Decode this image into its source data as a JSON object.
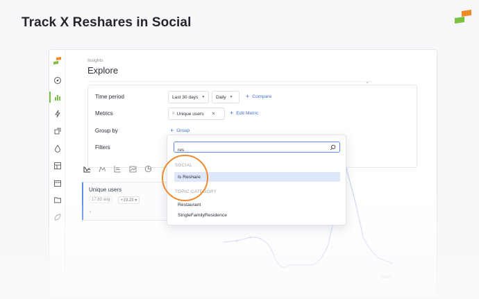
{
  "page_title": "Track X Reshares in Social",
  "colors": {
    "accent_blue": "#3d6fd6",
    "brand_green": "#7cc242",
    "brand_orange": "#f08a24",
    "highlight_ring": "#ee8a2e"
  },
  "sidebar": {
    "icons": [
      "compass-icon",
      "bar-chart-icon",
      "lightning-icon",
      "share-icon",
      "drop-icon",
      "layout-icon",
      "calendar-icon",
      "folder-icon",
      "leaf-icon"
    ],
    "active": "bar-chart-icon"
  },
  "header": {
    "breadcrumb": "Insights",
    "title": "Explore"
  },
  "filters": {
    "time_period": {
      "label": "Time period",
      "range": "Last 30 days",
      "granularity": "Daily",
      "compare": "Compare"
    },
    "metrics": {
      "label": "Metrics",
      "chip": "Unique users",
      "edit": "Edit Metric"
    },
    "group_by": {
      "label": "Group by",
      "add": "Group"
    },
    "filters_label": "Filters"
  },
  "metric_card": {
    "title": "Unique users",
    "avg": "17.63 avg",
    "delta": "+19.23"
  },
  "chart_data": {
    "type": "line",
    "x": [],
    "values": [],
    "x_tick_labels": [
      "Oct 23"
    ]
  },
  "dropdown": {
    "search": {
      "value": "res",
      "placeholder": ""
    },
    "sections": [
      {
        "title": "SOCIAL",
        "items": [
          "Is Reshare"
        ]
      },
      {
        "title": "TOPIC CATEGORY",
        "items": [
          "Restaurant",
          "SingleFamilyResidence"
        ]
      }
    ],
    "selected_item": "Is Reshare"
  }
}
